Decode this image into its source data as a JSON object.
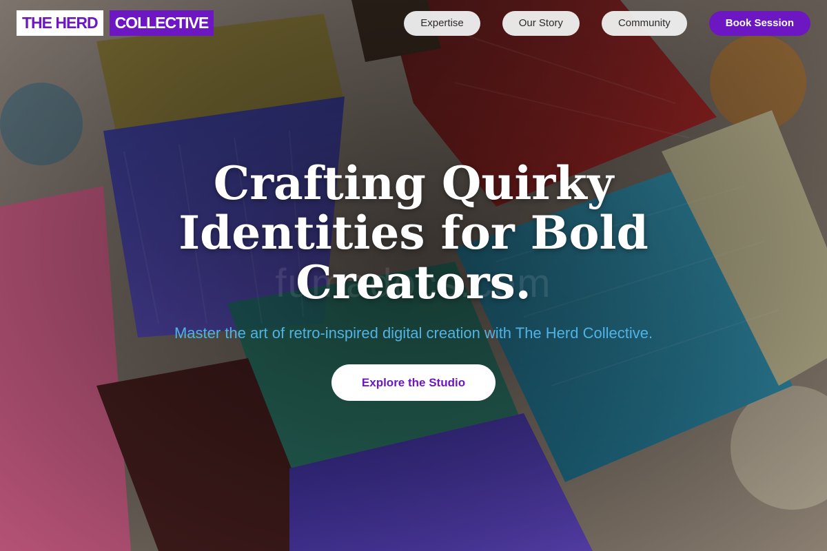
{
  "brand": {
    "part1": "THE HERD",
    "part2": "COLLECTIVE",
    "accent_color": "#6c17c2"
  },
  "nav": {
    "items": [
      {
        "label": "Expertise"
      },
      {
        "label": "Our Story"
      },
      {
        "label": "Community"
      }
    ],
    "cta_label": "Book Session"
  },
  "hero": {
    "headline": "Crafting Quirky Identities for Bold Creators.",
    "subhead": "Master the art of retro-inspired digital creation with The Herd Collective.",
    "subhead_color": "#4fb3e6",
    "cta_label": "Explore the Studio",
    "background_image": "paint-brushes-photo",
    "watermark": "fumadocs.com"
  }
}
